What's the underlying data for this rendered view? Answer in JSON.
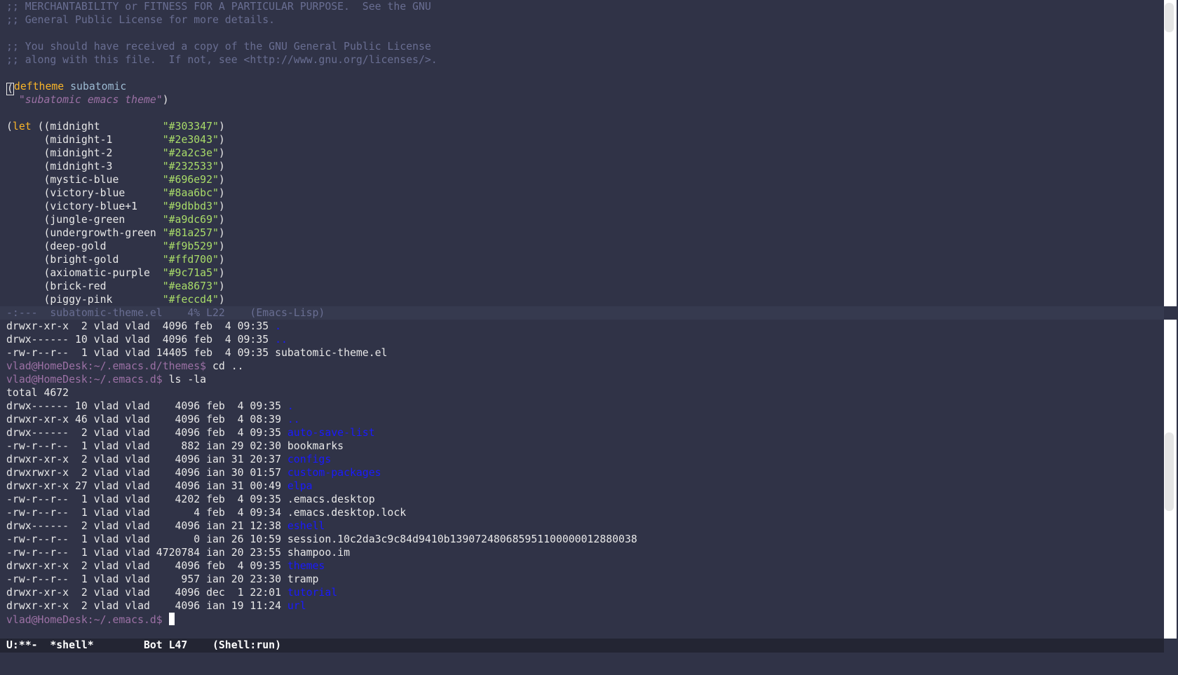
{
  "colors": {
    "background": "#303347",
    "comment": "#696e92",
    "keyword": "#f9b529",
    "function_name": "#9dbbd3",
    "docstring": "#9c71a5",
    "string": "#a9dc69",
    "directory": "#1a1aff",
    "prompt": "#9c71a5"
  },
  "editor": {
    "comment_lines": [
      ";; MERCHANTABILITY or FITNESS FOR A PARTICULAR PURPOSE.  See the GNU",
      ";; General Public License for more details.",
      ";; You should have received a copy of the GNU General Public License",
      ";; along with this file.  If not, see <http://www.gnu.org/licenses/>."
    ],
    "deftheme": {
      "open_paren": "(",
      "keyword": "deftheme",
      "name": "subatomic",
      "docstring": "\"subatomic emacs theme\"",
      "close_paren": ")"
    },
    "let": {
      "open": "(",
      "keyword": "let",
      "first_prefix": " ((",
      "first_name": "midnight",
      "first_value": "\"#303347\""
    },
    "bindings": [
      {
        "name": "midnight-1",
        "value": "\"#2e3043\""
      },
      {
        "name": "midnight-2",
        "value": "\"#2a2c3e\""
      },
      {
        "name": "midnight-3",
        "value": "\"#232533\""
      },
      {
        "name": "mystic-blue",
        "value": "\"#696e92\""
      },
      {
        "name": "victory-blue",
        "value": "\"#8aa6bc\""
      },
      {
        "name": "victory-blue+1",
        "value": "\"#9dbbd3\""
      },
      {
        "name": "jungle-green",
        "value": "\"#a9dc69\""
      },
      {
        "name": "undergrowth-green",
        "value": "\"#81a257\""
      },
      {
        "name": "deep-gold",
        "value": "\"#f9b529\""
      },
      {
        "name": "bright-gold",
        "value": "\"#ffd700\""
      },
      {
        "name": "axiomatic-purple",
        "value": "\"#9c71a5\""
      },
      {
        "name": "brick-red",
        "value": "\"#ea8673\""
      },
      {
        "name": "piggy-pink",
        "value": "\"#feccd4\""
      }
    ]
  },
  "modeline_top": "-:---  subatomic-theme.el    4% L22    (Emacs-Lisp)",
  "shell": {
    "first_listing": [
      {
        "info": "drwxr-xr-x  2 vlad vlad  4096 feb  4 09:35 ",
        "name": ".",
        "is_dir": true
      },
      {
        "info": "drwx------ 10 vlad vlad  4096 feb  4 09:35 ",
        "name": "..",
        "is_dir": true
      },
      {
        "info": "-rw-r--r--  1 vlad vlad 14405 feb  4 09:35 ",
        "name": "subatomic-theme.el",
        "is_dir": false
      }
    ],
    "prompt1": "vlad@HomeDesk:~/.emacs.d/themes$ ",
    "cmd1": "cd ..",
    "prompt2": "vlad@HomeDesk:~/.emacs.d$ ",
    "cmd2": "ls -la",
    "total": "total 4672",
    "second_listing": [
      {
        "info": "drwx------ 10 vlad vlad    4096 feb  4 09:35 ",
        "name": ".",
        "is_dir": true
      },
      {
        "info": "drwxr-xr-x 46 vlad vlad    4096 feb  4 08:39 ",
        "name": "..",
        "is_dir": true
      },
      {
        "info": "drwx------  2 vlad vlad    4096 feb  4 09:35 ",
        "name": "auto-save-list",
        "is_dir": true
      },
      {
        "info": "-rw-r--r--  1 vlad vlad     882 ian 29 02:30 ",
        "name": "bookmarks",
        "is_dir": false
      },
      {
        "info": "drwxr-xr-x  2 vlad vlad    4096 ian 31 20:37 ",
        "name": "configs",
        "is_dir": true
      },
      {
        "info": "drwxrwxr-x  2 vlad vlad    4096 ian 30 01:57 ",
        "name": "custom-packages",
        "is_dir": true
      },
      {
        "info": "drwxr-xr-x 27 vlad vlad    4096 ian 31 00:49 ",
        "name": "elpa",
        "is_dir": true
      },
      {
        "info": "-rw-r--r--  1 vlad vlad    4202 feb  4 09:35 ",
        "name": ".emacs.desktop",
        "is_dir": false
      },
      {
        "info": "-rw-r--r--  1 vlad vlad       4 feb  4 09:34 ",
        "name": ".emacs.desktop.lock",
        "is_dir": false
      },
      {
        "info": "drwx------  2 vlad vlad    4096 ian 21 12:38 ",
        "name": "eshell",
        "is_dir": true
      },
      {
        "info": "-rw-r--r--  1 vlad vlad       0 ian 26 10:59 ",
        "name": "session.10c2da3c9c84d9410b139072480685951100000012880038",
        "is_dir": false
      },
      {
        "info": "-rw-r--r--  1 vlad vlad 4720784 ian 20 23:55 ",
        "name": "shampoo.im",
        "is_dir": false
      },
      {
        "info": "drwxr-xr-x  2 vlad vlad    4096 feb  4 09:35 ",
        "name": "themes",
        "is_dir": true
      },
      {
        "info": "-rw-r--r--  1 vlad vlad     957 ian 20 23:30 ",
        "name": "tramp",
        "is_dir": false
      },
      {
        "info": "drwxr-xr-x  2 vlad vlad    4096 dec  1 22:01 ",
        "name": "tutorial",
        "is_dir": true
      },
      {
        "info": "drwxr-xr-x  2 vlad vlad    4096 ian 19 11:24 ",
        "name": "url",
        "is_dir": true
      }
    ],
    "prompt3": "vlad@HomeDesk:~/.emacs.d$ "
  },
  "modeline_bottom": "U:**-  *shell*        Bot L47    (Shell:run)"
}
